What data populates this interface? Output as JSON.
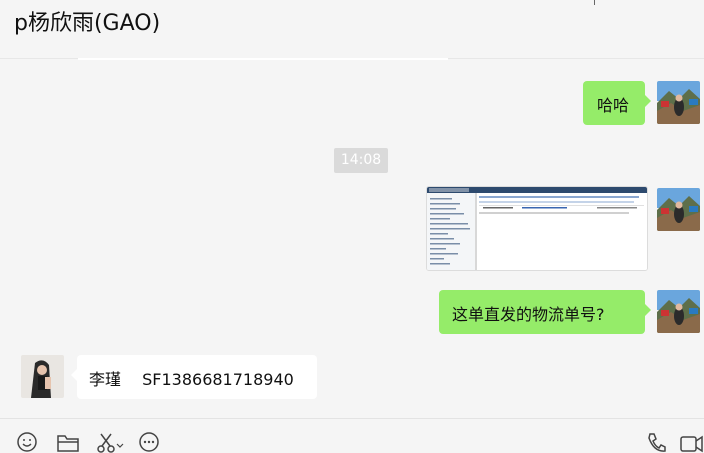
{
  "chat": {
    "title": "p杨欣雨(GAO)"
  },
  "messages": {
    "m1": {
      "text": "哈哈"
    },
    "timestamp": "14:08",
    "m3": {
      "text": "这单直发的物流单号?"
    },
    "m4": {
      "sender": "李瑾",
      "text": "SF1386681718940"
    }
  },
  "toolbar": {
    "icons": [
      "emoji-icon",
      "folder-icon",
      "scissors-icon",
      "chat-history-icon",
      "phone-icon",
      "video-icon"
    ]
  },
  "colors": {
    "outgoing_bubble": "#95ec69",
    "incoming_bubble": "#ffffff",
    "background": "#f5f5f5",
    "timestamp_bg": "#dadada"
  }
}
